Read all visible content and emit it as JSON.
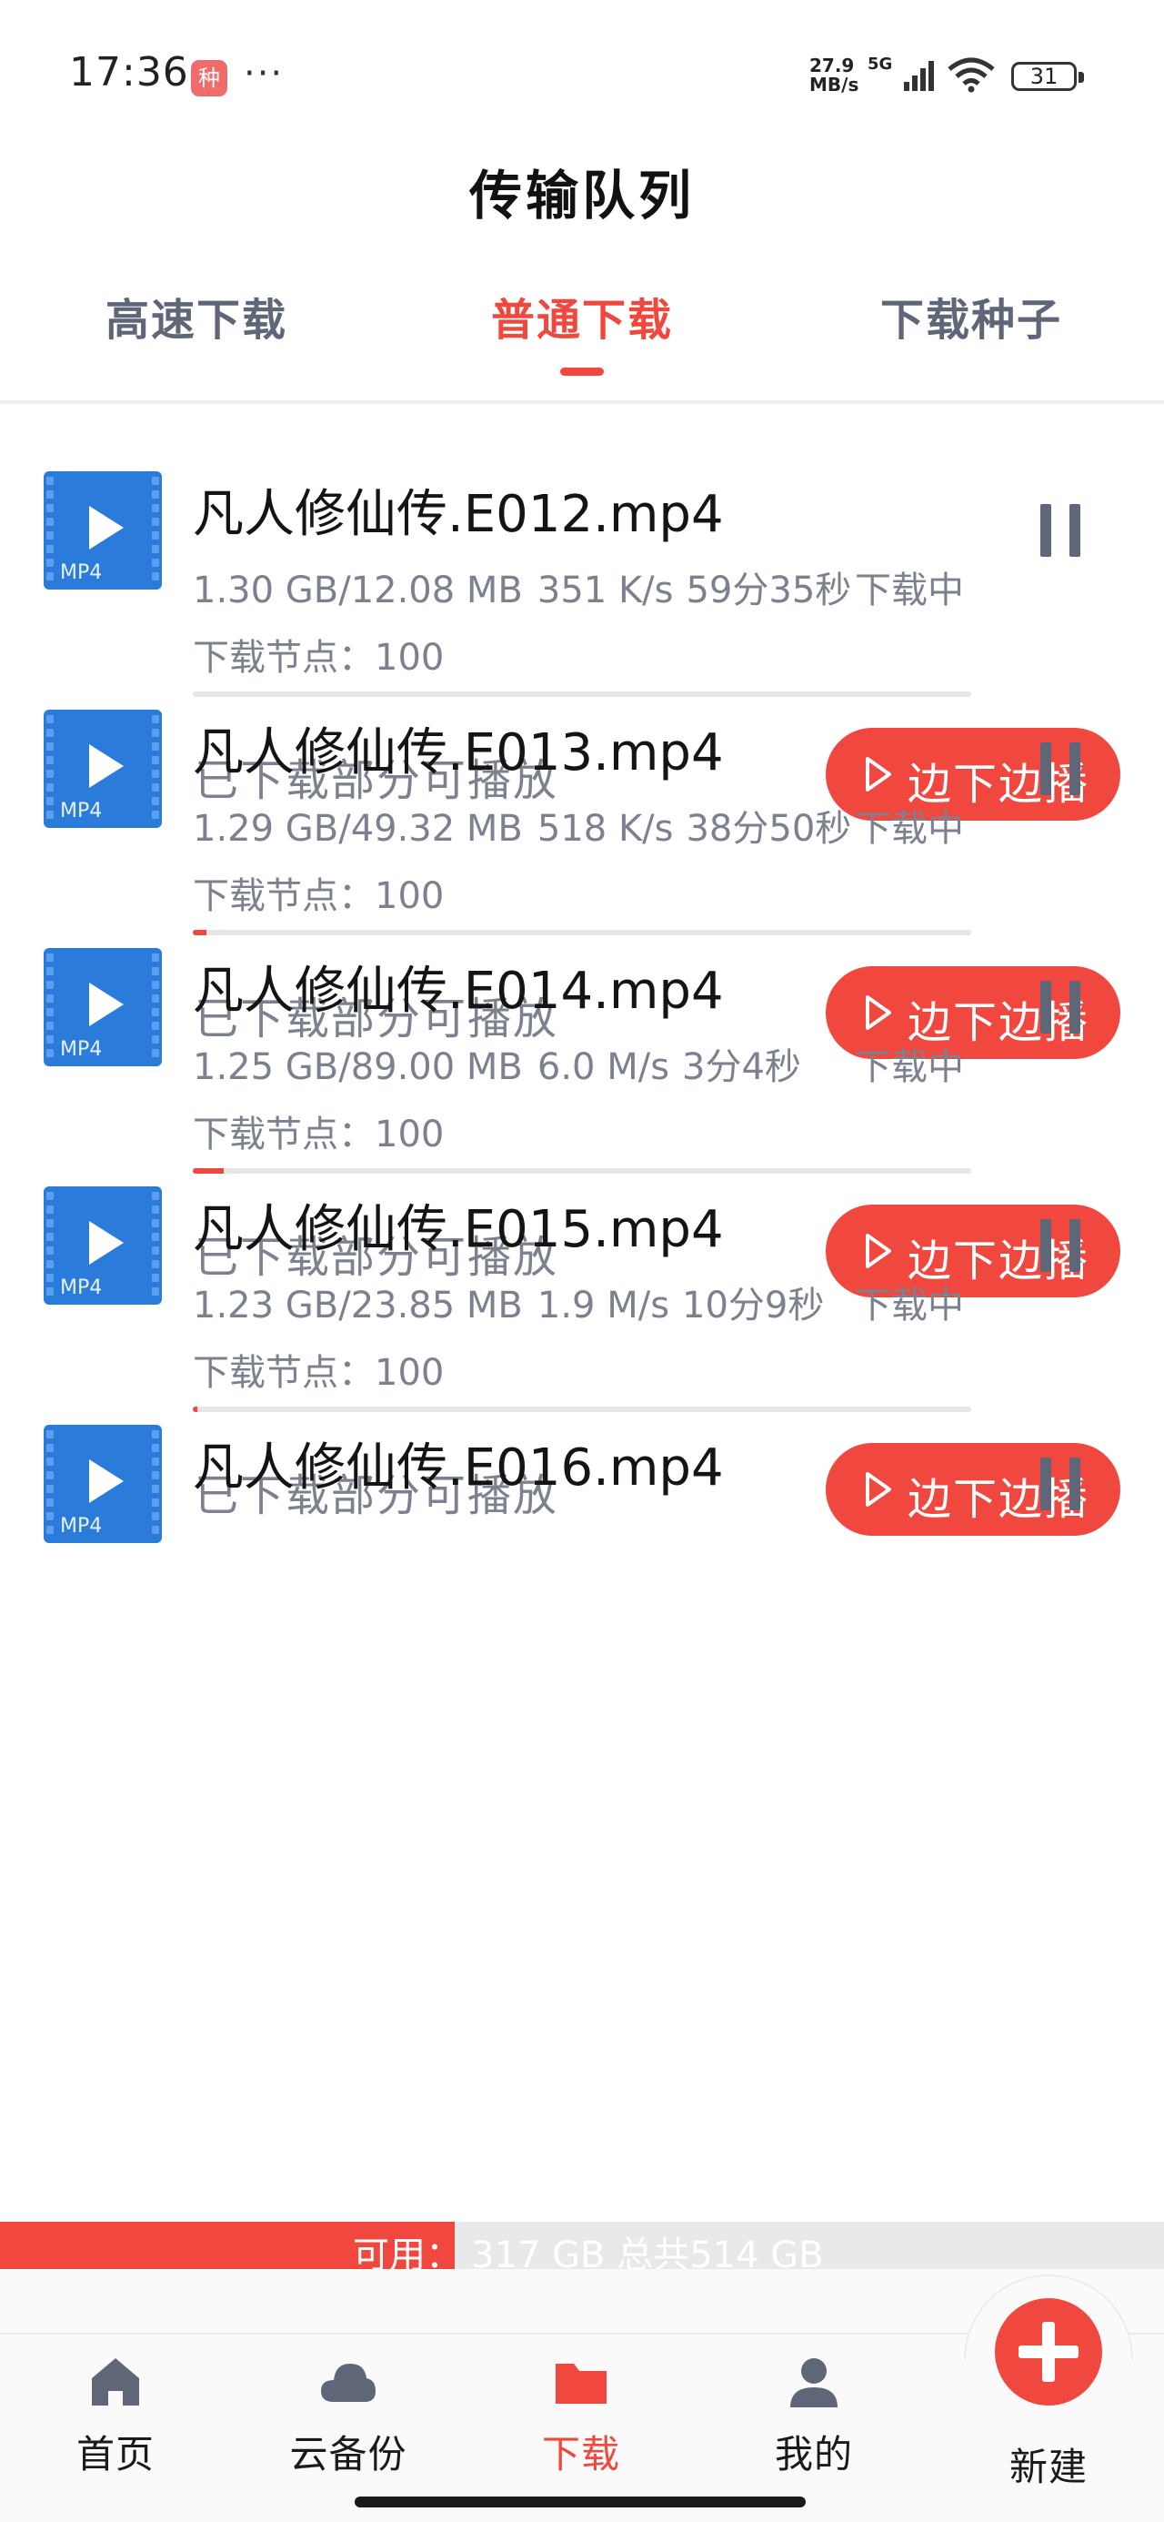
{
  "status_bar": {
    "time": "17:36",
    "badge": "种",
    "dots": "···",
    "net_speed_value": "27.9",
    "net_speed_unit": "MB/s",
    "network": "5G",
    "battery": "31"
  },
  "header": {
    "title": "传输队列",
    "tabs": [
      {
        "label": "高速下载",
        "active": false
      },
      {
        "label": "普通下载",
        "active": true
      },
      {
        "label": "下载种子",
        "active": false
      }
    ]
  },
  "downloads": [
    {
      "name": "凡人修仙传.E012.mp4",
      "icon": "mp4-video-icon",
      "ext": "MP4",
      "size": "1.30 GB/12.08 MB",
      "speed": "351 K/s",
      "remaining": "59分35秒",
      "status": "下载中",
      "nodes_label": "下载节点：",
      "nodes": "100",
      "progress": 0.0,
      "playable_label": "已下载部分可播放",
      "play_button": "边下边播"
    },
    {
      "name": "凡人修仙传.E013.mp4",
      "icon": "mp4-video-icon",
      "ext": "MP4",
      "size": "1.29 GB/49.32 MB",
      "speed": "518 K/s",
      "remaining": "38分50秒",
      "status": "下载中",
      "nodes_label": "下载节点：",
      "nodes": "100",
      "progress": 0.017,
      "playable_label": "已下载部分可播放",
      "play_button": "边下边播"
    },
    {
      "name": "凡人修仙传.E014.mp4",
      "icon": "mp4-video-icon",
      "ext": "MP4",
      "size": "1.25 GB/89.00 MB",
      "speed": "6.0 M/s",
      "remaining": "3分4秒",
      "status": "下载中",
      "nodes_label": "下载节点：",
      "nodes": "100",
      "progress": 0.04,
      "playable_label": "已下载部分可播放",
      "play_button": "边下边播"
    },
    {
      "name": "凡人修仙传.E015.mp4",
      "icon": "mp4-video-icon",
      "ext": "MP4",
      "size": "1.23 GB/23.85 MB",
      "speed": "1.9 M/s",
      "remaining": "10分9秒",
      "status": "下载中",
      "nodes_label": "下载节点：",
      "nodes": "100",
      "progress": 0.006,
      "playable_label": "已下载部分可播放",
      "play_button": "边下边播"
    },
    {
      "name": "凡人修仙传.E016.mp4",
      "icon": "mp4-video-icon",
      "ext": "MP4",
      "size": "",
      "speed": "",
      "remaining": "",
      "status": "",
      "nodes_label": "",
      "nodes": "",
      "progress": 0.0,
      "playable_label": "",
      "play_button": ""
    }
  ],
  "storage": {
    "label": "可用：",
    "value": "317 GB 总共514 GB"
  },
  "bottom_nav": [
    {
      "label": "首页",
      "icon": "home-icon",
      "active": false
    },
    {
      "label": "云备份",
      "icon": "cloud-icon",
      "active": false
    },
    {
      "label": "下载",
      "icon": "folder-icon",
      "active": true
    },
    {
      "label": "我的",
      "icon": "person-icon",
      "active": false
    },
    {
      "label": "新建",
      "icon": "plus-icon",
      "active": false
    }
  ],
  "colors": {
    "accent": "#f0483e",
    "tab_inactive": "#5e6678",
    "secondary_text": "#7c8190",
    "video_icon": "#2b7bdb",
    "bolt": "#f7d31a"
  }
}
